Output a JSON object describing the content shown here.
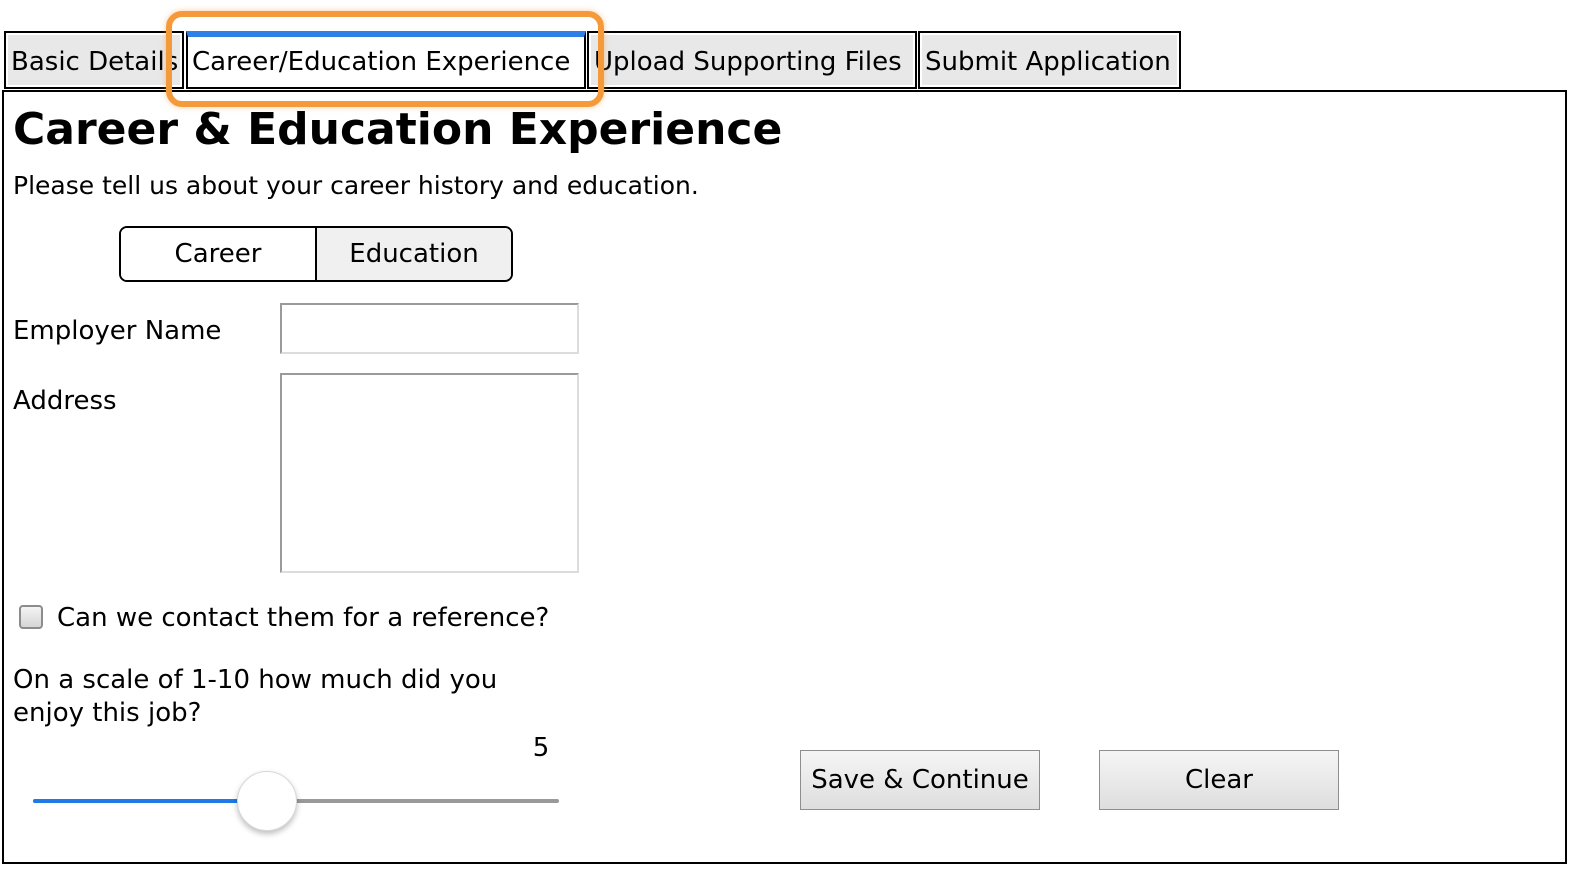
{
  "tabs": [
    {
      "label": "Basic Details",
      "active": false
    },
    {
      "label": "Career/Education Experience",
      "active": true
    },
    {
      "label": "Upload Supporting Files",
      "active": false
    },
    {
      "label": "Submit Application",
      "active": false
    }
  ],
  "page": {
    "title": "Career & Education Experience",
    "subtitle": "Please tell us about your career history and education."
  },
  "section_toggle": {
    "options": [
      "Career",
      "Education"
    ],
    "selected": "Career"
  },
  "form": {
    "employer_name_label": "Employer Name",
    "employer_name_value": "",
    "address_label": "Address",
    "address_value": "",
    "reference_checkbox_label": "Can we contact them for a reference?",
    "reference_checked": false,
    "enjoyment_question": "On a scale of 1-10 how much did you enjoy this job?",
    "enjoyment_value": "5",
    "enjoyment_min": 1,
    "enjoyment_max": 10
  },
  "actions": {
    "save_label": "Save & Continue",
    "clear_label": "Clear"
  },
  "colors": {
    "active_tab_accent": "#2f7fe6",
    "highlight": "#f59a3a",
    "slider_fill": "#1f7ae8"
  }
}
